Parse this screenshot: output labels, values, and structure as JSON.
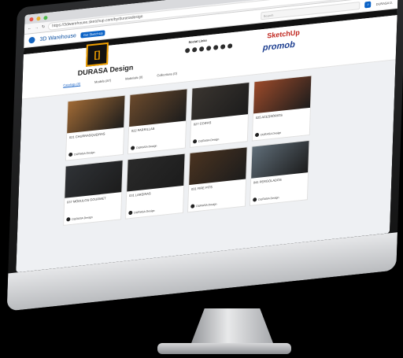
{
  "browser": {
    "url": "https://3dwarehouse.sketchup.com/by/durasadesign"
  },
  "header": {
    "brand": "3D Warehouse",
    "badge": "Get SketchUp",
    "search_placeholder": "Search",
    "user": "DURASA D."
  },
  "profile": {
    "logo_glyph": "[]",
    "name": "DURASA Design",
    "social_title": "Social Links",
    "partner1": "SketchUp",
    "partner2": "promob"
  },
  "tabs": [
    "Catalogs (8)",
    "Models (87)",
    "Materials (0)",
    "Collections (0)"
  ],
  "cards": [
    {
      "title": "021 CHURRASQUEIRAS",
      "author": "DURASA Design",
      "color": "#a06a35"
    },
    {
      "title": "022 PARRILLAS",
      "author": "DURASA Design",
      "color": "#6b4a2c"
    },
    {
      "title": "027 COIFAS",
      "author": "DURASA Design",
      "color": "#3a3530"
    },
    {
      "title": "025 ACESSÓRIOS",
      "author": "DURASA Design",
      "color": "#9b4a2a"
    },
    {
      "title": "037 MÓDULOS GOURMET",
      "author": "DURASA Design",
      "color": "#2f3236"
    },
    {
      "title": "031 LAREIRAS",
      "author": "DURASA Design",
      "color": "#2a2a2a"
    },
    {
      "title": "031 FIRE PITS",
      "author": "DURASA Design",
      "color": "#4a3320"
    },
    {
      "title": "041 PERGOLADOS",
      "author": "DURASA Design",
      "color": "#5f6d78"
    }
  ]
}
